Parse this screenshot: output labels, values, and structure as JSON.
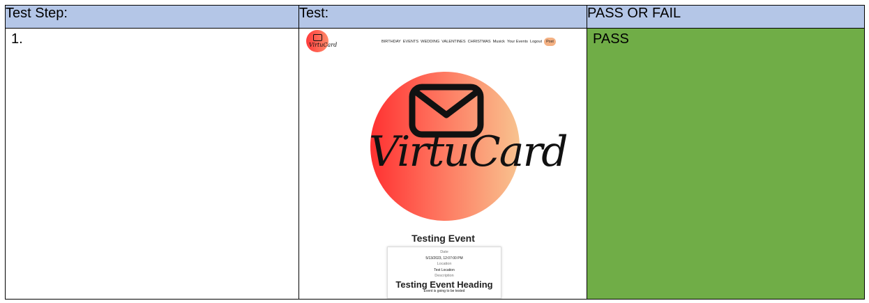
{
  "headers": {
    "step": "Test Step:",
    "test": "Test:",
    "result": "PASS OR FAIL"
  },
  "rows": [
    {
      "step": "1.",
      "result": "PASS",
      "screenshot": {
        "logo_wordmark": "VirtuCard",
        "nav": [
          "BIRTHDAY",
          "EVENTS",
          "WEDDING",
          "VALENTINES",
          "CHRISTMAS",
          "Musick",
          "Your Events",
          "Logout"
        ],
        "nav_post": "Post",
        "event_title": "Testing Event",
        "card": {
          "date_label": "Date",
          "date_value": "5/13/2023, 12:07:00 PM",
          "location_label": "Location",
          "location_value": "Test Location",
          "description_label": "Description",
          "heading": "Testing Event Heading",
          "description": "Event is going to be tested"
        }
      }
    }
  ],
  "colors": {
    "header_bg": "#b4c6e7",
    "pass_bg": "#70ad47"
  }
}
